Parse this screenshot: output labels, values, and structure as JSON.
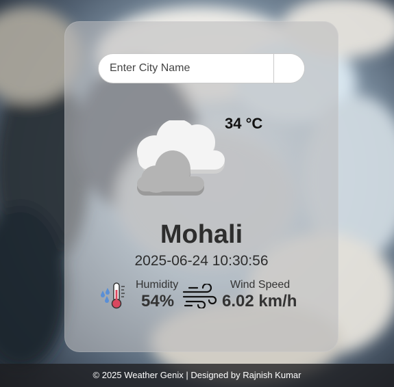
{
  "search": {
    "placeholder": "Enter City Name",
    "value": ""
  },
  "weather": {
    "icon": "cloudy-icon",
    "temperature": "34 °C",
    "city": "Mohali",
    "datetime": "2025-06-24 10:30:56"
  },
  "details": {
    "humidity_label": "Humidity",
    "humidity_value": "54%",
    "wind_label": "Wind Speed",
    "wind_value": "6.02 km/h"
  },
  "footer": {
    "text": "© 2025 Weather Genix | Designed by Rajnish Kumar"
  },
  "colors": {
    "card": "#bcbcbe",
    "text_dark": "#2d2d2d",
    "footer_bg": "#1e1e20",
    "thermometer_red": "#d9485f",
    "raindrop_blue": "#5a8fd6"
  }
}
